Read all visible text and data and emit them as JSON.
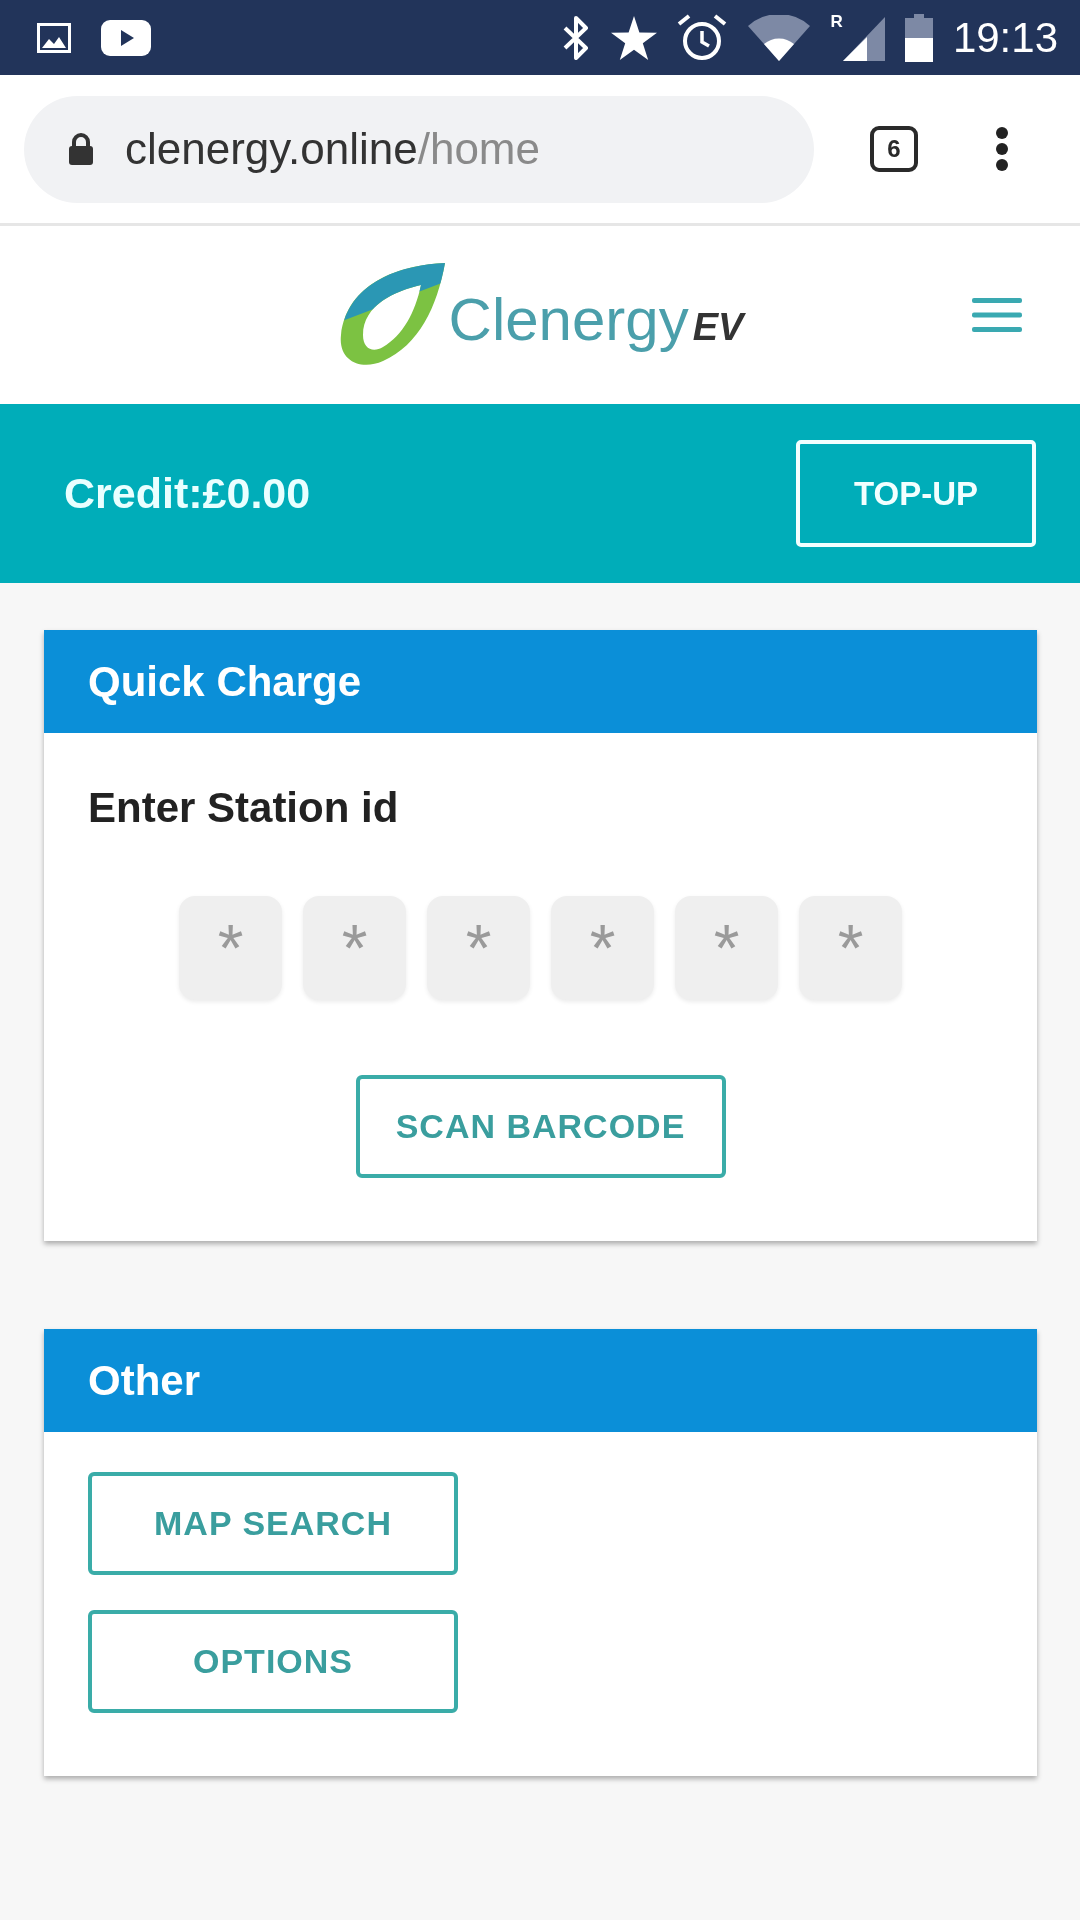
{
  "status_bar": {
    "network_badge": "R",
    "time": "19:13"
  },
  "browser": {
    "url_host": "clenergy.online",
    "url_path": "/home",
    "tab_count": "6"
  },
  "header": {
    "brand_name": "Clenergy",
    "brand_suffix": "EV"
  },
  "credit_bar": {
    "credit": "Credit:£0.00",
    "button": "TOP-UP"
  },
  "cards": [
    {
      "kind": "station_entry",
      "title": "Quick Charge",
      "prompt": "Enter Station id",
      "digit_fields": [
        {
          "placeholder": "*"
        },
        {
          "placeholder": "*"
        },
        {
          "placeholder": "*"
        },
        {
          "placeholder": "*"
        },
        {
          "placeholder": "*"
        },
        {
          "placeholder": "*"
        }
      ],
      "button": "SCAN BARCODE"
    },
    {
      "kind": "links",
      "title": "Other",
      "buttons": [
        "MAP SEARCH",
        "OPTIONS"
      ]
    }
  ]
}
